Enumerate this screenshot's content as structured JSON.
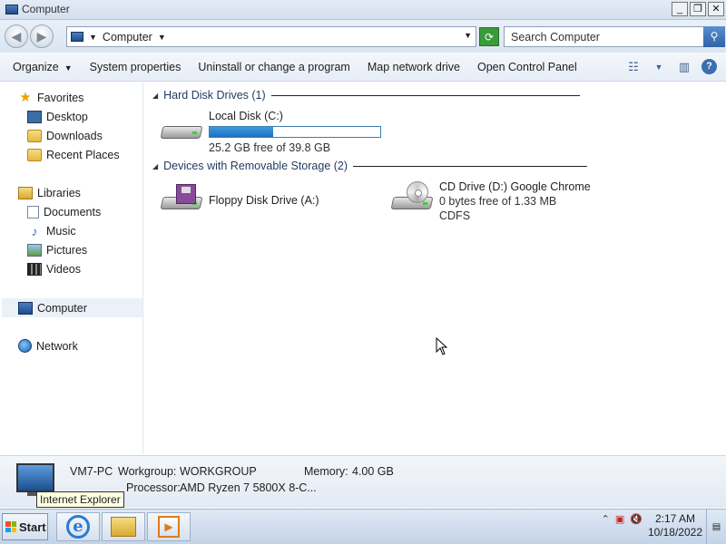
{
  "window": {
    "title": "Computer"
  },
  "address": {
    "path": "Computer"
  },
  "search": {
    "placeholder": "Search Computer"
  },
  "toolbar": {
    "organize": "Organize",
    "system_properties": "System properties",
    "uninstall": "Uninstall or change a program",
    "map_drive": "Map network drive",
    "control_panel": "Open Control Panel"
  },
  "nav": {
    "favorites": "Favorites",
    "desktop": "Desktop",
    "downloads": "Downloads",
    "recent": "Recent Places",
    "libraries": "Libraries",
    "documents": "Documents",
    "music": "Music",
    "pictures": "Pictures",
    "videos": "Videos",
    "computer": "Computer",
    "network": "Network"
  },
  "groups": {
    "hdd": "Hard Disk Drives (1)",
    "removable": "Devices with Removable Storage (2)"
  },
  "drives": {
    "c": {
      "name": "Local Disk (C:)",
      "free": "25.2 GB free of 39.8 GB",
      "used_fraction": 0.37
    },
    "a": {
      "name": "Floppy Disk Drive (A:)"
    },
    "d": {
      "name": "CD Drive (D:) Google Chrome",
      "free": "0 bytes free of 1.33 MB",
      "fs": "CDFS"
    }
  },
  "details": {
    "pc_name": "VM7-PC",
    "workgroup_label": "Workgroup:",
    "workgroup": "WORKGROUP",
    "memory_label": "Memory:",
    "memory": "4.00 GB",
    "processor_label": "Processor:",
    "processor": "AMD Ryzen 7 5800X 8-C..."
  },
  "tooltip": "Internet Explorer",
  "taskbar": {
    "start": "Start",
    "time": "2:17 AM",
    "date": "10/18/2022"
  }
}
